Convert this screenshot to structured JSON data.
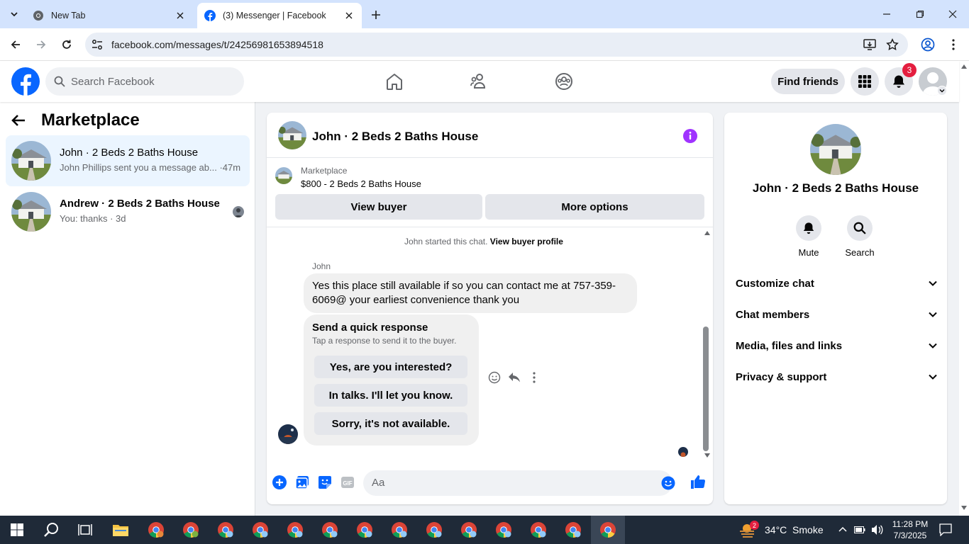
{
  "browser": {
    "tabs": [
      {
        "title": "New Tab",
        "icon": "chrome-icon",
        "active": false
      },
      {
        "title": "(3) Messenger | Facebook",
        "icon": "facebook-favicon",
        "active": true
      }
    ],
    "url": "facebook.com/messages/t/24256981653894518"
  },
  "fb_header": {
    "search_placeholder": "Search Facebook",
    "find_friends_label": "Find friends",
    "notification_count": "3"
  },
  "left_panel": {
    "title": "Marketplace",
    "conversations": [
      {
        "name": "John · 2 Beds 2 Baths House",
        "snippet": "John Phillips sent you a message ab... ·47m",
        "active": true
      },
      {
        "name": "Andrew · 2 Beds 2 Baths House",
        "snippet": "You: thanks · 3d",
        "active": false
      }
    ]
  },
  "chat": {
    "title": "John · 2 Beds 2 Baths House",
    "marketplace_label": "Marketplace",
    "listing": "$800 - 2 Beds 2 Baths House",
    "view_buyer_label": "View buyer",
    "more_options_label": "More options",
    "system_message": "John started this chat.",
    "system_link": "View buyer profile",
    "sender_name": "John",
    "message_text": "Yes this place still available if so you can contact me at 757-359-6069@ your earliest convenience thank you",
    "quick_response": {
      "title": "Send a quick response",
      "subtitle": "Tap a response to send it to the buyer.",
      "options": [
        "Yes, are you interested?",
        "In talks. I'll let you know.",
        "Sorry, it's not available."
      ]
    },
    "composer_placeholder": "Aa"
  },
  "right_panel": {
    "title": "John · 2 Beds 2 Baths House",
    "mute_label": "Mute",
    "search_label": "Search",
    "sections": [
      "Customize chat",
      "Chat members",
      "Media, files and links",
      "Privacy & support"
    ]
  },
  "taskbar": {
    "weather_badge": "2",
    "weather_text": "34°C  Smoke",
    "time": "11:28 PM",
    "date": "7/3/2025"
  },
  "colors": {
    "fb_blue": "#0866ff",
    "messenger_purple": "#a033ff",
    "active_conv_bg": "#ebf5ff",
    "notif_red": "#e41e3f",
    "taskbar_bg": "#1f2a38"
  }
}
